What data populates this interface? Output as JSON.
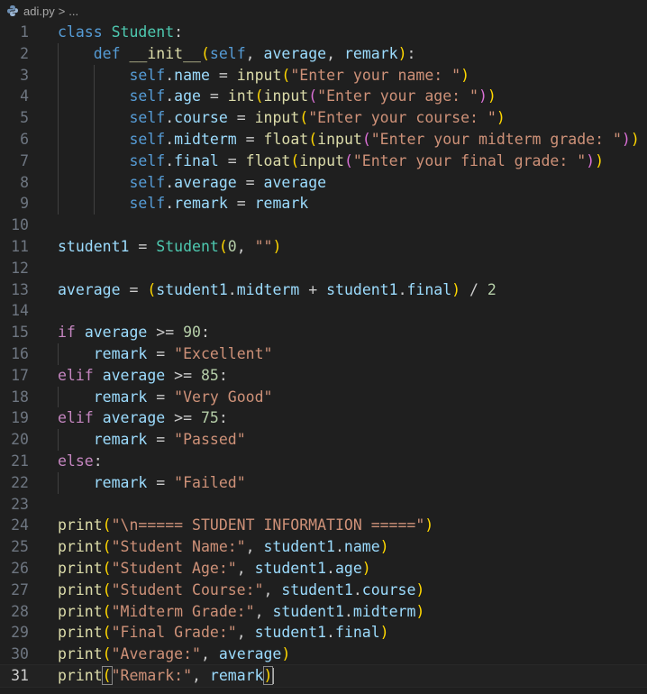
{
  "breadcrumb": {
    "file": "adi.py",
    "separator": ">",
    "symbol": "..."
  },
  "editor": {
    "active_line": 31,
    "line_numbers": [
      "1",
      "2",
      "3",
      "4",
      "5",
      "6",
      "7",
      "8",
      "9",
      "10",
      "11",
      "12",
      "13",
      "14",
      "15",
      "16",
      "17",
      "18",
      "19",
      "20",
      "21",
      "22",
      "23",
      "24",
      "25",
      "26",
      "27",
      "28",
      "29",
      "30",
      "31"
    ],
    "lines": [
      "class Student:",
      "    def __init__(self, average, remark):",
      "        self.name = input(\"Enter your name: \")",
      "        self.age = int(input(\"Enter your age: \"))",
      "        self.course = input(\"Enter your course: \")",
      "        self.midterm = float(input(\"Enter your midterm grade: \"))",
      "        self.final = float(input(\"Enter your final grade: \"))",
      "        self.average = average",
      "        self.remark = remark",
      "",
      "student1 = Student(0, \"\")",
      "",
      "average = (student1.midterm + student1.final) / 2",
      "",
      "if average >= 90:",
      "    remark = \"Excellent\"",
      "elif average >= 85:",
      "    remark = \"Very Good\"",
      "elif average >= 75:",
      "    remark = \"Passed\"",
      "else:",
      "    remark = \"Failed\"",
      "",
      "print(\"\\n===== STUDENT INFORMATION =====\")",
      "print(\"Student Name:\", student1.name)",
      "print(\"Student Age:\", student1.age)",
      "print(\"Student Course:\", student1.course)",
      "print(\"Midterm Grade:\", student1.midterm)",
      "print(\"Final Grade:\", student1.final)",
      "print(\"Average:\", average)",
      "print(\"Remark:\", remark)"
    ]
  },
  "colors": {
    "background": "#1f1f1f",
    "keyword": "#569cd6",
    "control": "#c586c0",
    "function": "#dcdcaa",
    "class": "#4ec9b0",
    "string": "#ce9178",
    "number": "#b5cea8",
    "variable": "#9cdcfe",
    "bracket_1": "#ffd700",
    "bracket_2": "#da70d6",
    "bracket_3": "#179fff"
  },
  "icons": {
    "file_icon": "python-file-icon"
  }
}
